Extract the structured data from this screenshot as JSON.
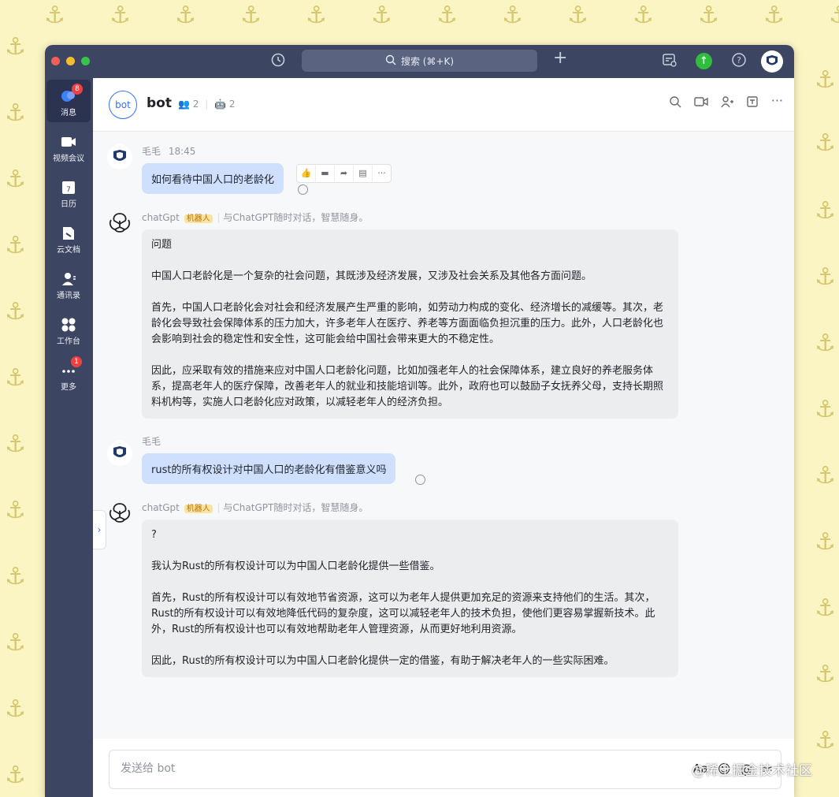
{
  "window": {
    "search_placeholder": "搜索 (⌘+K)",
    "search_icon": "search-icon",
    "history_icon": "history-icon",
    "add_icon": "plus-icon"
  },
  "sidebar": {
    "items": [
      {
        "label": "消息",
        "badge": "8",
        "icon": "chat-icon"
      },
      {
        "label": "视频会议",
        "badge": "",
        "icon": "video-icon"
      },
      {
        "label": "日历",
        "badge": "",
        "icon": "calendar-icon"
      },
      {
        "label": "云文档",
        "badge": "",
        "icon": "docs-icon"
      },
      {
        "label": "通讯录",
        "badge": "",
        "icon": "contacts-icon"
      },
      {
        "label": "工作台",
        "badge": "",
        "icon": "workspace-icon"
      },
      {
        "label": "更多",
        "badge": "1",
        "icon": "more-icon"
      }
    ]
  },
  "chat": {
    "avatar_text": "bot",
    "title": "bot",
    "members": "2",
    "bots": "2"
  },
  "messages": [
    {
      "sender": "毛毛",
      "time": "18:45",
      "text": "如何看待中国人口的老龄化"
    },
    {
      "sender": "chatGpt",
      "tag": "机器人",
      "desc": "与ChatGPT随时对话，智慧随身。",
      "paragraphs": [
        "问题",
        "中国人口老龄化是一个复杂的社会问题，其既涉及经济发展，又涉及社会关系及其他各方面问题。",
        "首先，中国人口老龄化会对社会和经济发展产生严重的影响，如劳动力构成的变化、经济增长的减缓等。其次，老龄化会导致社会保障体系的压力加大，许多老年人在医疗、养老等方面面临负担沉重的压力。此外，人口老龄化也会影响到社会的稳定性和安全性，这可能会给中国社会带来更大的不稳定性。",
        "因此，应采取有效的措施来应对中国人口老龄化问题，比如加强老年人的社会保障体系，建立良好的养老服务体系，提高老年人的医疗保障，改善老年人的就业和技能培训等。此外，政府也可以鼓励子女抚养父母，支持长期照料机构等，实施人口老龄化应对政策，以减轻老年人的经济负担。"
      ]
    },
    {
      "sender": "毛毛",
      "text": "rust的所有权设计对中国人口的老龄化有借鉴意义吗"
    },
    {
      "sender": "chatGpt",
      "tag": "机器人",
      "desc": "与ChatGPT随时对话，智慧随身。",
      "paragraphs": [
        "?",
        "我认为Rust的所有权设计可以为中国人口老龄化提供一些借鉴。",
        "首先，Rust的所有权设计可以有效地节省资源，这可以为老年人提供更加充足的资源来支持他们的生活。其次，Rust的所有权设计可以有效地降低代码的复杂度，这可以减轻老年人的技术负担，使他们更容易掌握新技术。此外，Rust的所有权设计也可以有效地帮助老年人管理资源，从而更好地利用资源。",
        "因此，Rust的所有权设计可以为中国人口老龄化提供一定的借鉴，有助于解决老年人的一些实际困难。"
      ]
    }
  ],
  "input": {
    "placeholder": "发送给 bot"
  },
  "watermark": "@稀土掘金技术社区"
}
